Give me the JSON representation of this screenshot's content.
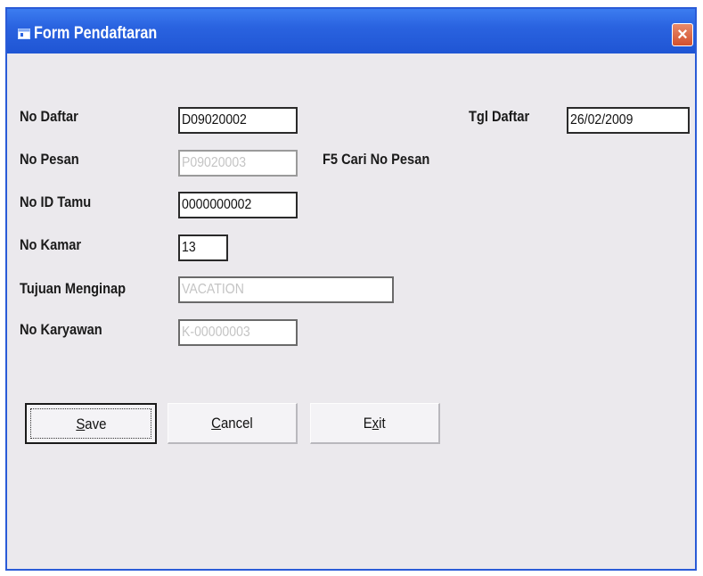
{
  "window": {
    "title": "Form Pendaftaran",
    "close_label": "×"
  },
  "form": {
    "no_daftar": {
      "label": "No Daftar",
      "value": "D09020002"
    },
    "tgl_daftar": {
      "label": "Tgl Daftar",
      "value": "26/02/2009"
    },
    "no_pesan": {
      "label": "No Pesan",
      "value": "P09020003",
      "hint": "F5 Cari No Pesan"
    },
    "no_id_tamu": {
      "label": "No ID Tamu",
      "value": "0000000002"
    },
    "no_kamar": {
      "label": "No Kamar",
      "value": "13"
    },
    "tujuan_menginap": {
      "label": "Tujuan Menginap",
      "value": "VACATION"
    },
    "no_karyawan": {
      "label": "No Karyawan",
      "value": "K-00000003"
    }
  },
  "buttons": {
    "save": {
      "mnemonic": "S",
      "rest": "ave"
    },
    "cancel": {
      "mnemonic": "C",
      "rest": "ancel"
    },
    "exit": {
      "pre": "E",
      "mnemonic": "x",
      "rest": "it"
    }
  }
}
